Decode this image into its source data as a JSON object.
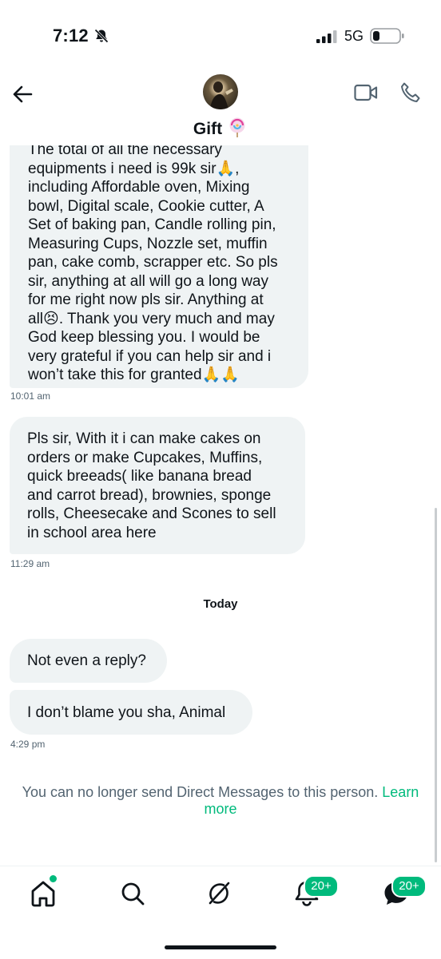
{
  "status_bar": {
    "time": "7:12",
    "network": "5G"
  },
  "header": {
    "name": "Gift"
  },
  "messages": [
    {
      "text": "The total of all the necessary\nequipments i need is 99k sir🙏,\nincluding Affordable oven, Mixing\nbowl, Digital scale, Cookie cutter, A\nSet of baking pan, Candle rolling pin,\nMeasuring Cups, Nozzle set, muffin\npan, cake comb, scrapper etc. So pls\nsir, anything at all will go a long way\nfor me right now pls sir. Anything at\nall😣. Thank you very much and may\nGod keep blessing you. I would be\nvery grateful if you can help sir and i\nwon’t take this for granted🙏🙏",
      "time": "10:01 am"
    },
    {
      "text": "Pls sir, With it i can make cakes on\norders or make Cupcakes, Muffins,\nquick breeads( like banana bread\nand carrot bread), brownies, sponge\nrolls, Cheesecake and Scones to sell\nin school area here",
      "time": "11:29 am"
    },
    {
      "text": "Not even a reply?"
    },
    {
      "text": "I don’t blame you sha, Animal",
      "time": "4:29 pm"
    }
  ],
  "day_separator": "Today",
  "notice": {
    "text": "You can no longer send Direct Messages to this person.",
    "link": "Learn more"
  },
  "tabbar": {
    "notifications_badge": "20+",
    "messages_badge": "20+"
  },
  "colors": {
    "accent": "#00ba7c",
    "bubble": "#eff3f4",
    "muted": "#536471"
  },
  "icons": [
    "bell-slash-icon",
    "signal-icon",
    "battery-icon",
    "back-arrow-icon",
    "video-icon",
    "phone-icon",
    "home-icon",
    "search-icon",
    "grok-icon",
    "bell-icon",
    "messages-icon"
  ]
}
